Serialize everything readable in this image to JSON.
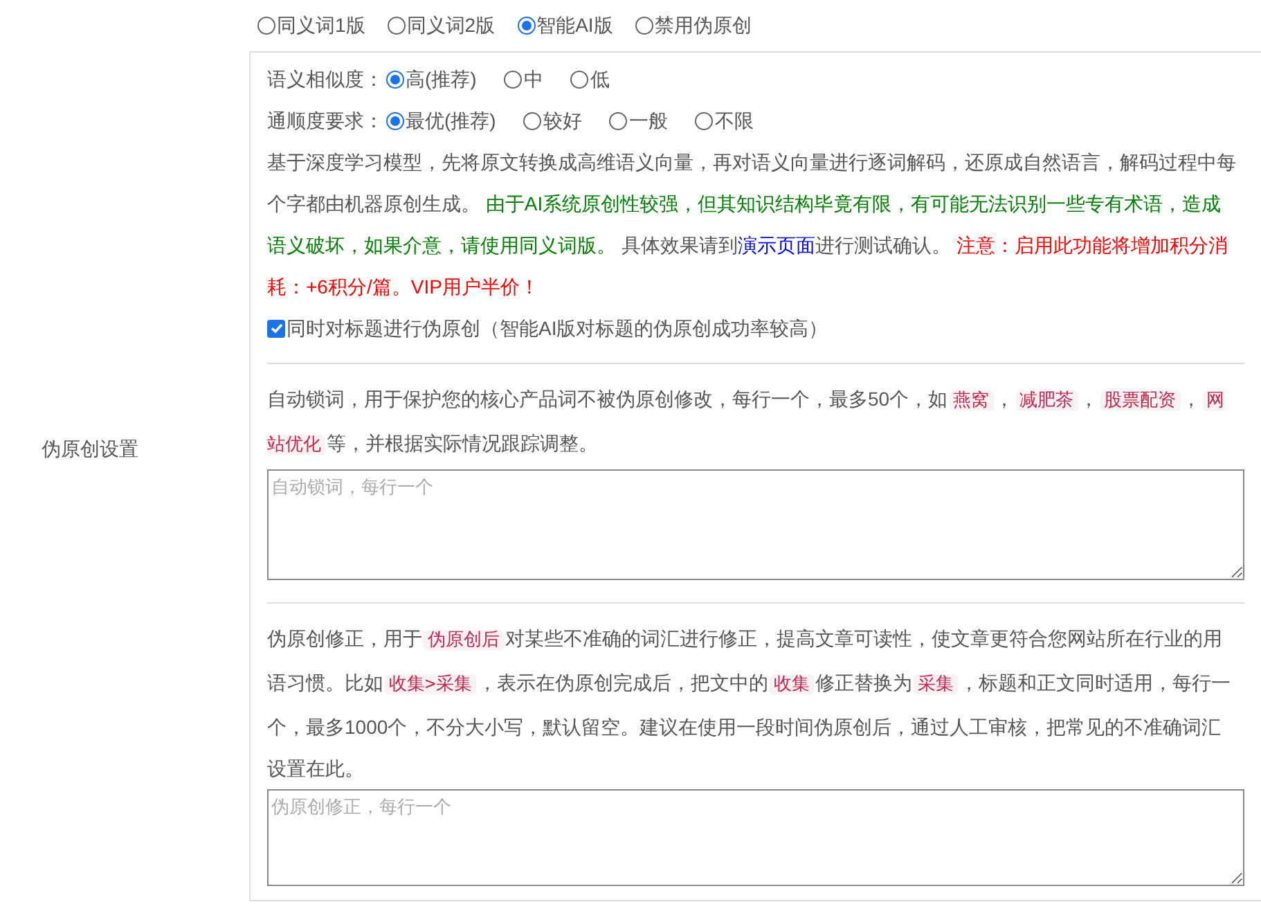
{
  "side_label": "伪原创设置",
  "versions": [
    {
      "label": "同义词1版",
      "selected": false
    },
    {
      "label": "同义词2版",
      "selected": false
    },
    {
      "label": "智能AI版",
      "selected": true
    },
    {
      "label": "禁用伪原创",
      "selected": false
    }
  ],
  "settings": [
    {
      "label": "语义相似度：",
      "options": [
        {
          "label": "高(推荐)",
          "selected": true
        },
        {
          "label": "中",
          "selected": false
        },
        {
          "label": "低",
          "selected": false
        }
      ]
    },
    {
      "label": "通顺度要求：",
      "options": [
        {
          "label": "最优(推荐)",
          "selected": true
        },
        {
          "label": "较好",
          "selected": false
        },
        {
          "label": "一般",
          "selected": false
        },
        {
          "label": "不限",
          "selected": false
        }
      ]
    }
  ],
  "ai_description": [
    {
      "kind": "text",
      "text": "基于深度学习模型，先将原文转换成高维语义向量，再对语义向量进行逐词解码，还原成自然语言，解码过程中每个字都由机器原创生成。 "
    },
    {
      "kind": "green",
      "text": "由于AI系统原创性较强，但其知识结构毕竟有限，有可能无法识别一些专有术语，造成语义破坏，如果介意，请使用同义词版。"
    },
    {
      "kind": "text",
      "text": " 具体效果请到"
    },
    {
      "kind": "link",
      "text": "演示页面"
    },
    {
      "kind": "text",
      "text": "进行测试确认。 "
    },
    {
      "kind": "red",
      "text": "注意：启用此功能将增加积分消耗：+6积分/篇。VIP用户半价！"
    }
  ],
  "title_checkbox": {
    "label": "同时对标题进行伪原创（智能AI版对标题的伪原创成功率较高）",
    "checked": true
  },
  "lock_words": {
    "description": [
      {
        "kind": "text",
        "text": "自动锁词，用于保护您的核心产品词不被伪原创修改，每行一个，最多50个，如"
      },
      {
        "kind": "tag",
        "text": "燕窝"
      },
      {
        "kind": "text",
        "text": "，"
      },
      {
        "kind": "tag",
        "text": "减肥茶"
      },
      {
        "kind": "text",
        "text": "，"
      },
      {
        "kind": "tag",
        "text": "股票配资"
      },
      {
        "kind": "text",
        "text": "，"
      },
      {
        "kind": "tag",
        "text": "网站优化"
      },
      {
        "kind": "text",
        "text": "等，并根据实际情况跟踪调整。"
      }
    ],
    "placeholder": "自动锁词，每行一个"
  },
  "correction": {
    "description": [
      {
        "kind": "text",
        "text": "伪原创修正，用于"
      },
      {
        "kind": "tag",
        "text": "伪原创后"
      },
      {
        "kind": "text",
        "text": "对某些不准确的词汇进行修正，提高文章可读性，使文章更符合您网站所在行业的用语习惯。比如"
      },
      {
        "kind": "tag",
        "text": "收集>采集"
      },
      {
        "kind": "text",
        "text": "，表示在伪原创完成后，把文中的"
      },
      {
        "kind": "tag",
        "text": "收集"
      },
      {
        "kind": "text",
        "text": "修正替换为"
      },
      {
        "kind": "tag",
        "text": "采集"
      },
      {
        "kind": "text",
        "text": "，标题和正文同时适用，每行一个，最多1000个，不分大小写，默认留空。建议在使用一段时间伪原创后，通过人工审核，把常见的不准确词汇设置在此。"
      }
    ],
    "placeholder": "伪原创修正，每行一个"
  }
}
